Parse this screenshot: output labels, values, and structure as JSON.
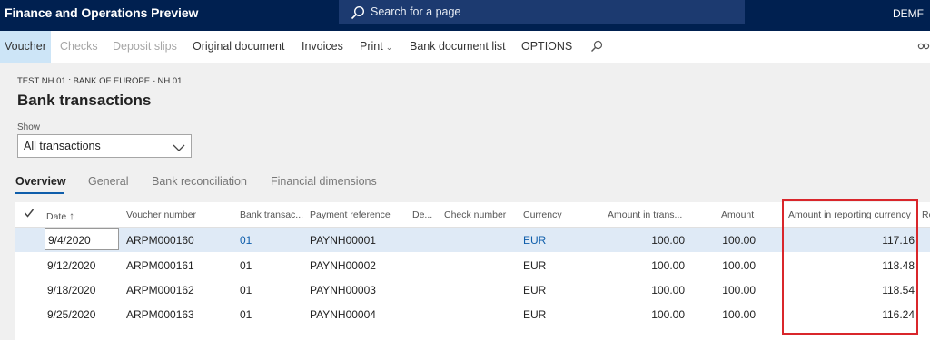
{
  "topbar": {
    "app_title": "Finance and Operations Preview",
    "search_placeholder": "Search for a page",
    "company": "DEMF"
  },
  "actions": [
    {
      "label": "Voucher",
      "state": "selected"
    },
    {
      "label": "Checks",
      "state": "disabled"
    },
    {
      "label": "Deposit slips",
      "state": "disabled"
    },
    {
      "label": "Original document",
      "state": "enabled"
    },
    {
      "label": "Invoices",
      "state": "enabled"
    },
    {
      "label": "Print",
      "state": "enabled"
    },
    {
      "label": "Bank document list",
      "state": "enabled"
    },
    {
      "label": "OPTIONS",
      "state": "enabled"
    }
  ],
  "breadcrumb": "TEST NH 01 : BANK OF EUROPE - NH 01",
  "page_title": "Bank transactions",
  "filter": {
    "label": "Show",
    "value": "All transactions"
  },
  "tabs": [
    "Overview",
    "General",
    "Bank reconciliation",
    "Financial dimensions"
  ],
  "grid": {
    "columns": [
      "Date",
      "Voucher number",
      "Bank transac...",
      "Payment reference",
      "De...",
      "Check number",
      "Currency",
      "Amount in trans...",
      "Amount",
      "Amount in reporting currency",
      "Re"
    ],
    "rows": [
      {
        "date": "9/4/2020",
        "voucher": "ARPM000160",
        "bank_trans": "01",
        "payment_ref": "PAYNH00001",
        "currency": "EUR",
        "amount_trans": "100.00",
        "amount": "100.00",
        "amount_reporting": "117.16"
      },
      {
        "date": "9/12/2020",
        "voucher": "ARPM000161",
        "bank_trans": "01",
        "payment_ref": "PAYNH00002",
        "currency": "EUR",
        "amount_trans": "100.00",
        "amount": "100.00",
        "amount_reporting": "118.48"
      },
      {
        "date": "9/18/2020",
        "voucher": "ARPM000162",
        "bank_trans": "01",
        "payment_ref": "PAYNH00003",
        "currency": "EUR",
        "amount_trans": "100.00",
        "amount": "100.00",
        "amount_reporting": "118.54"
      },
      {
        "date": "9/25/2020",
        "voucher": "ARPM000163",
        "bank_trans": "01",
        "payment_ref": "PAYNH00004",
        "currency": "EUR",
        "amount_trans": "100.00",
        "amount": "100.00",
        "amount_reporting": "116.24"
      }
    ]
  },
  "colors": {
    "header_bg": "#002050",
    "accent": "#0f5eab",
    "highlight": "#d9262b",
    "selected_row": "#dfeaf6"
  }
}
